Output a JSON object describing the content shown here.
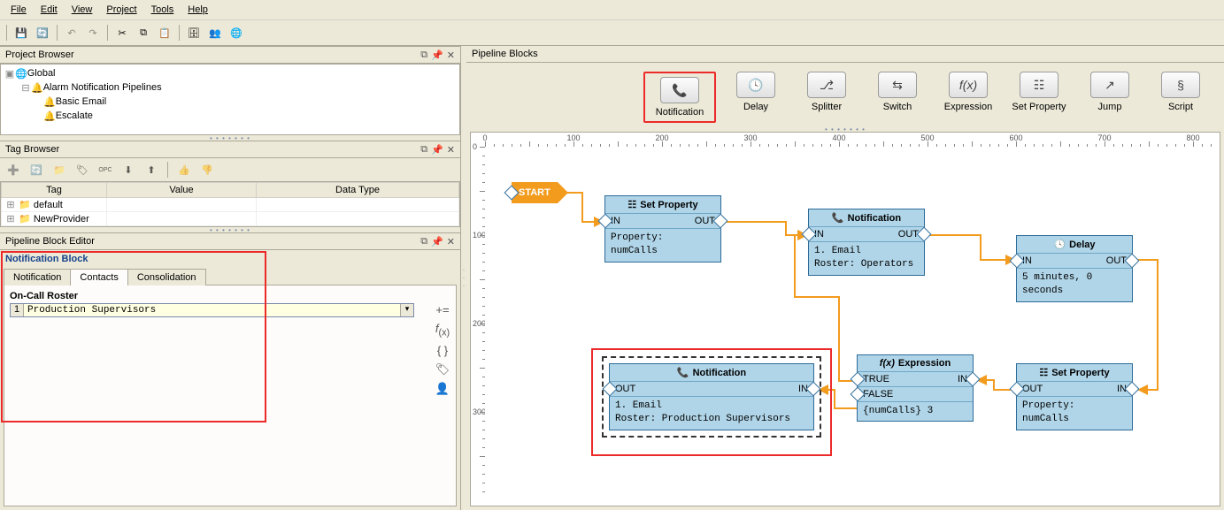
{
  "menu": {
    "file": "File",
    "edit": "Edit",
    "view": "View",
    "project": "Project",
    "tools": "Tools",
    "help": "Help"
  },
  "panels": {
    "projectBrowser": "Project Browser",
    "tagBrowser": "Tag Browser",
    "pipelineBlockEditor": "Pipeline Block Editor",
    "pipelineBlocks": "Pipeline Blocks"
  },
  "projectTree": {
    "root": "Global",
    "alarm": "Alarm Notification Pipelines",
    "p1": "Basic Email",
    "p2": "Escalate"
  },
  "tagTable": {
    "hTag": "Tag",
    "hValue": "Value",
    "hType": "Data Type",
    "r1": "default",
    "r2": "NewProvider"
  },
  "editor": {
    "title": "Notification Block",
    "tabNotification": "Notification",
    "tabContacts": "Contacts",
    "tabConsolidation": "Consolidation",
    "rosterLbl": "On-Call Roster",
    "rosterIdx": "1",
    "rosterVal": "Production Supervisors"
  },
  "palette": {
    "notification": "Notification",
    "delay": "Delay",
    "splitter": "Splitter",
    "switch": "Switch",
    "expression": "Expression",
    "setprop": "Set Property",
    "jump": "Jump",
    "script": "Script"
  },
  "blocks": {
    "start": "START",
    "setprop1": {
      "title": "Set Property",
      "in": "IN",
      "out": "OUT",
      "body": "Property: numCalls"
    },
    "notif1": {
      "title": "Notification",
      "in": "IN",
      "out": "OUT",
      "l1": "1. Email",
      "l2": "Roster: Operators"
    },
    "delay": {
      "title": "Delay",
      "in": "IN",
      "out": "OUT",
      "body": "5 minutes, 0 seconds"
    },
    "setprop2": {
      "title": "Set Property",
      "in": "IN",
      "out": "OUT",
      "body": "Property: numCalls"
    },
    "expr": {
      "title": "Expression",
      "t": "TRUE",
      "f": "FALSE",
      "in": "IN",
      "body": "{numCalls} 3"
    },
    "notif2": {
      "title": "Notification",
      "in": "IN",
      "out": "OUT",
      "l1": "1. Email",
      "l2": "Roster: Production Supervisors"
    }
  },
  "rulerH": [
    0,
    100,
    200,
    300,
    400,
    500,
    600,
    700,
    800
  ],
  "rulerV": [
    0,
    100,
    200,
    300
  ]
}
